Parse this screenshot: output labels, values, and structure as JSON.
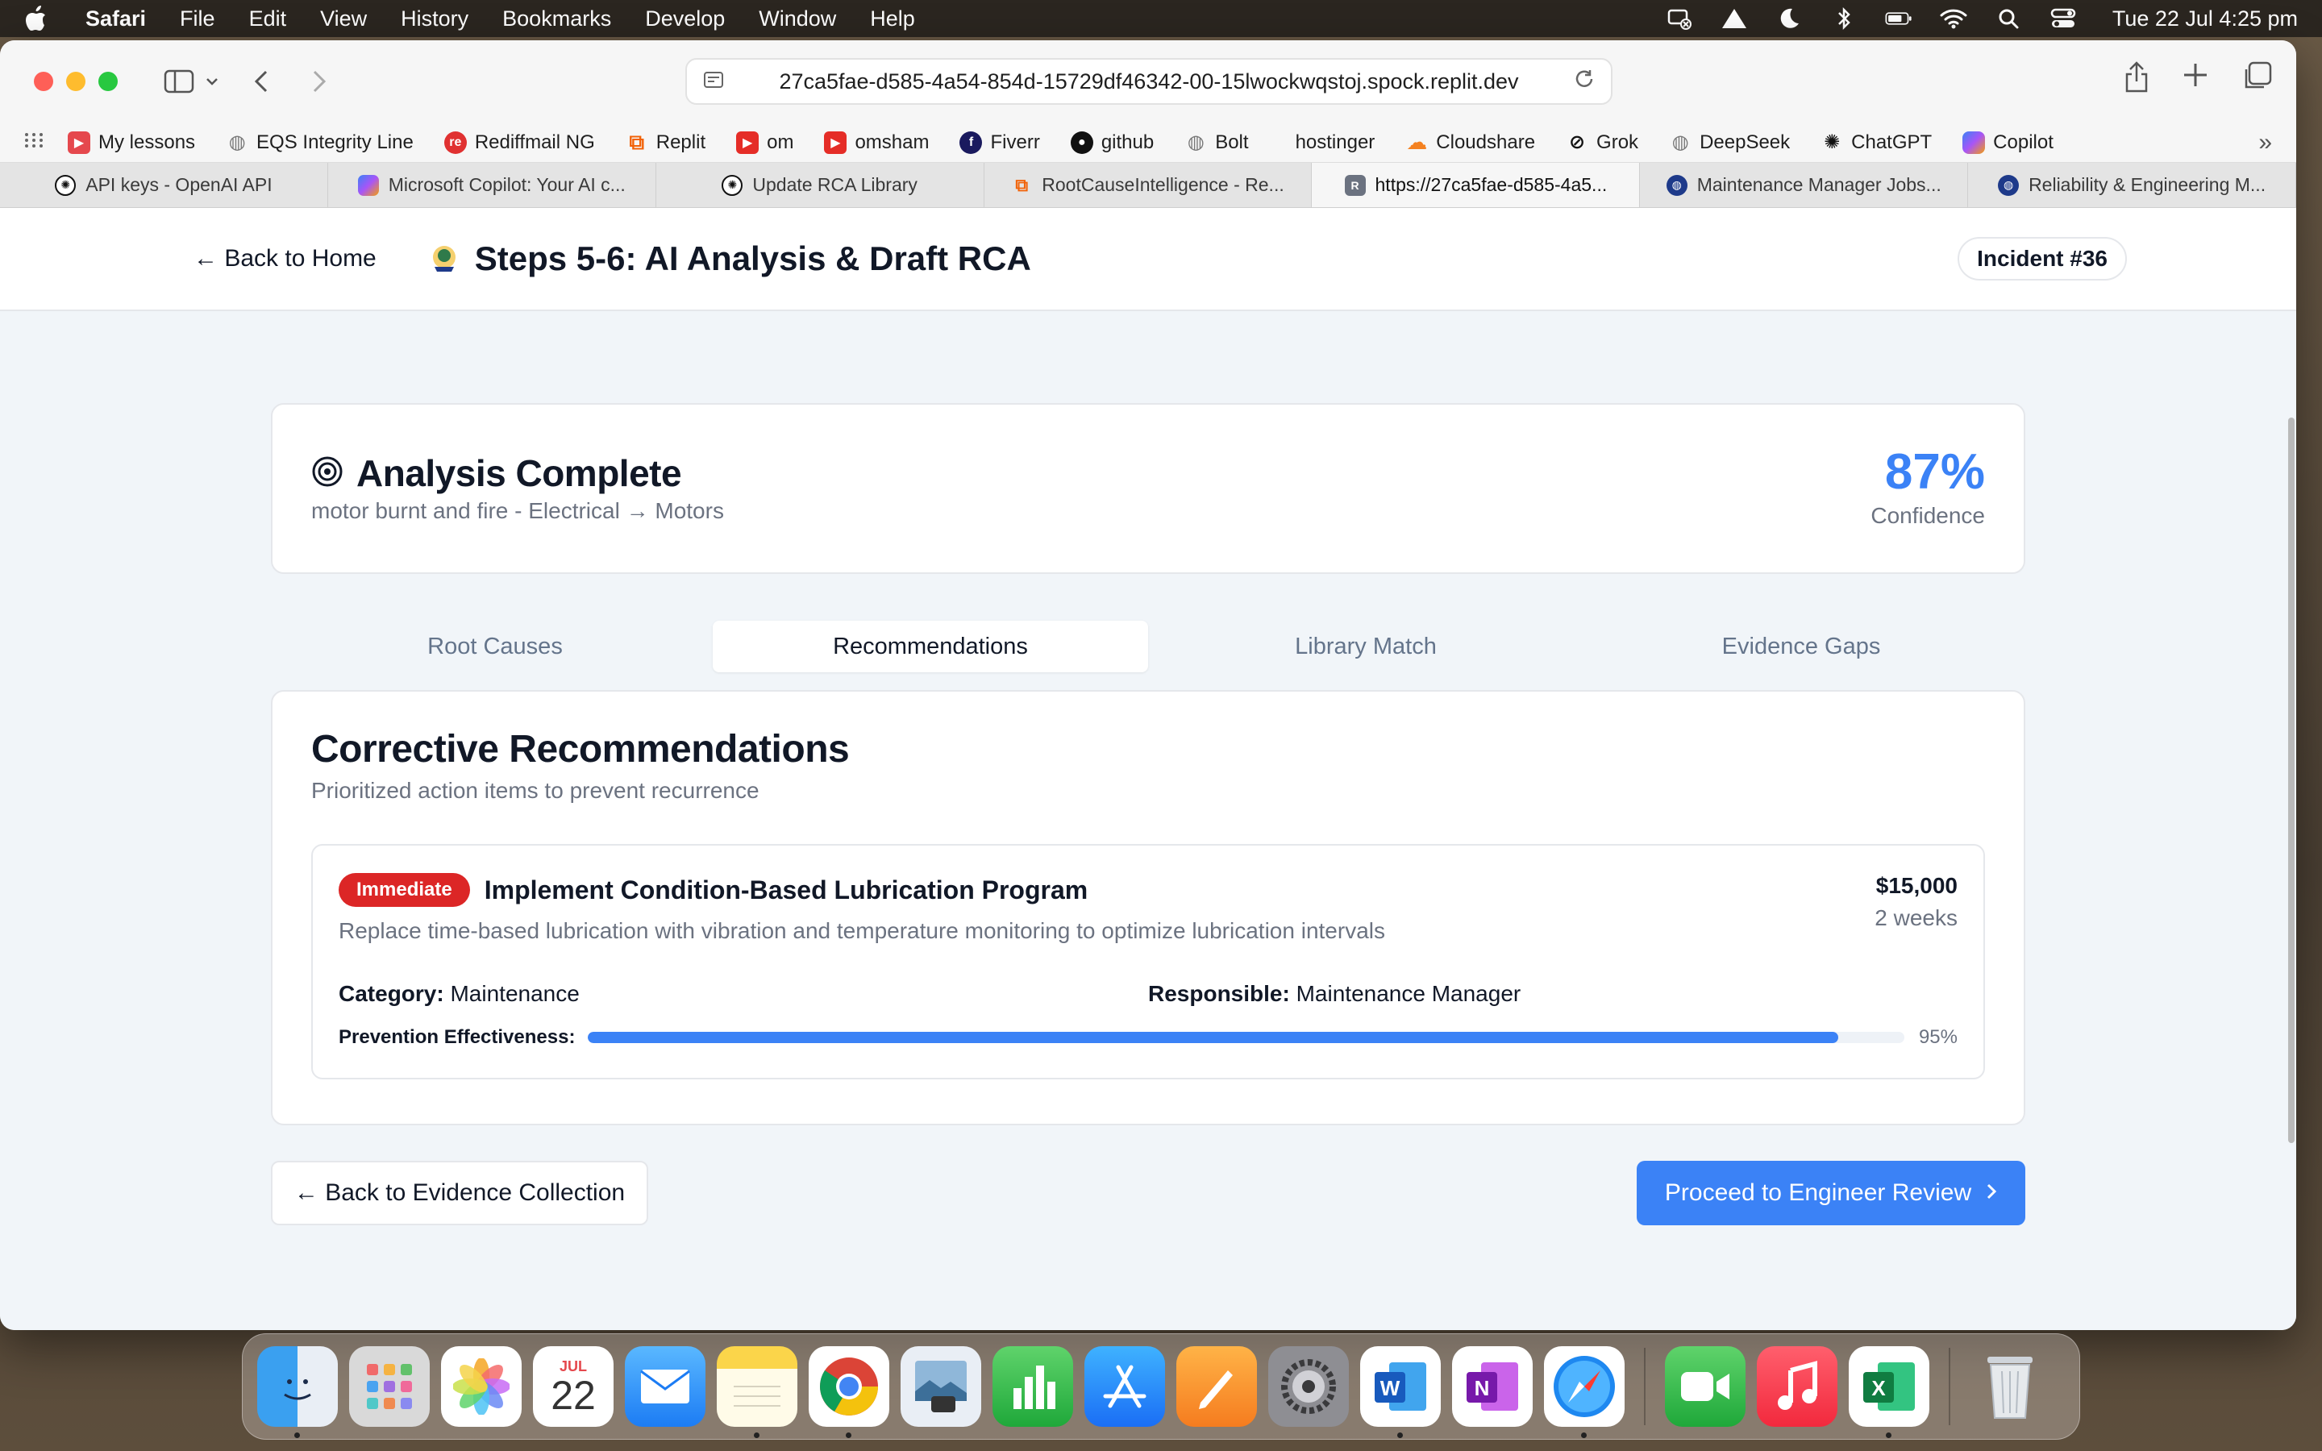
{
  "menubar": {
    "app_name": "Safari",
    "items": [
      "File",
      "Edit",
      "View",
      "History",
      "Bookmarks",
      "Develop",
      "Window",
      "Help"
    ],
    "clock": "Tue 22 Jul  4:25 pm"
  },
  "browser": {
    "url": "27ca5fae-d585-4a54-854d-15729df46342-00-15lwockwqstoj.spock.replit.dev",
    "favorites": [
      {
        "label": "My lessons",
        "icon": "play-icon",
        "color": "#e5484d"
      },
      {
        "label": "EQS Integrity Line",
        "icon": "globe-icon",
        "color": "#8a8a8a"
      },
      {
        "label": "Rediffmail NG",
        "icon": "rediff-icon",
        "color": "#e03131"
      },
      {
        "label": "Replit",
        "icon": "replit-icon",
        "color": "#f26207"
      },
      {
        "label": "om",
        "icon": "youtube-icon",
        "color": "#e52d27"
      },
      {
        "label": "omsham",
        "icon": "youtube-icon",
        "color": "#e52d27"
      },
      {
        "label": "Fiverr",
        "icon": "fiverr-icon",
        "color": "#1a1a5e"
      },
      {
        "label": "github",
        "icon": "github-icon",
        "color": "#111111"
      },
      {
        "label": "Bolt",
        "icon": "globe-icon",
        "color": "#8a8a8a"
      },
      {
        "label": "hostinger",
        "icon": "none",
        "color": "transparent"
      },
      {
        "label": "Cloudshare",
        "icon": "cloud-icon",
        "color": "#f48120"
      },
      {
        "label": "Grok",
        "icon": "grok-icon",
        "color": "#111111"
      },
      {
        "label": "DeepSeek",
        "icon": "globe-icon",
        "color": "#8a8a8a"
      },
      {
        "label": "ChatGPT",
        "icon": "openai-icon",
        "color": "#111111"
      },
      {
        "label": "Copilot",
        "icon": "copilot-icon",
        "color": "#7b61ff"
      }
    ],
    "tabs": [
      {
        "label": "API keys - OpenAI API",
        "icon": "openai-icon",
        "color": "#111111",
        "active": false
      },
      {
        "label": "Microsoft Copilot: Your AI c...",
        "icon": "copilot-icon",
        "color": "#7b61ff",
        "active": false
      },
      {
        "label": "Update RCA Library",
        "icon": "openai-icon",
        "color": "#111111",
        "active": false
      },
      {
        "label": "RootCauseIntelligence - Re...",
        "icon": "replit-icon",
        "color": "#f26207",
        "active": false
      },
      {
        "label": "https://27ca5fae-d585-4a5...",
        "icon": "r-icon",
        "color": "#6b7280",
        "active": true
      },
      {
        "label": "Maintenance Manager Jobs...",
        "icon": "globe-icon",
        "color": "#1e3a8a",
        "active": false
      },
      {
        "label": "Reliability & Engineering M...",
        "icon": "globe-icon",
        "color": "#1e3a8a",
        "active": false
      }
    ]
  },
  "header": {
    "back_label": "← Back to Home",
    "title": "Steps 5-6: AI Analysis & Draft RCA",
    "incident": "Incident #36"
  },
  "summary": {
    "title": "Analysis Complete",
    "subtitle": "motor burnt and fire - Electrical → Motors",
    "confidence_value": "87%",
    "confidence_label": "Confidence"
  },
  "analysis_tabs": [
    {
      "label": "Root Causes",
      "active": false
    },
    {
      "label": "Recommendations",
      "active": true
    },
    {
      "label": "Library Match",
      "active": false
    },
    {
      "label": "Evidence Gaps",
      "active": false
    }
  ],
  "recommendations": {
    "title": "Corrective Recommendations",
    "description": "Prioritized action items to prevent recurrence",
    "items": [
      {
        "priority": "Immediate",
        "title": "Implement Condition-Based Lubrication Program",
        "description": "Replace time-based lubrication with vibration and temperature monitoring to optimize lubrication intervals",
        "cost": "$15,000",
        "timeframe": "2 weeks",
        "category_label": "Category:",
        "category": "Maintenance",
        "responsible_label": "Responsible:",
        "responsible": "Maintenance Manager",
        "effectiveness_label": "Prevention Effectiveness:",
        "effectiveness_pct": 95,
        "effectiveness_text": "95%"
      }
    ]
  },
  "actions": {
    "back_label": "← Back to Evidence Collection",
    "proceed_label": "Proceed to Engineer Review"
  },
  "colors": {
    "accent": "#3b82f6",
    "priority_immediate": "#dc2626"
  },
  "dock": {
    "calendar_month": "JUL",
    "calendar_day": "22",
    "apps": [
      "finder-icon",
      "launchpad-icon",
      "photos-icon",
      "calendar-icon",
      "mail-icon",
      "notes-icon",
      "chrome-icon",
      "preview-icon",
      "numbers-icon",
      "app-store-icon",
      "pages-icon",
      "system-settings-icon",
      "word-icon",
      "onenote-icon",
      "safari-icon",
      "facetime-icon",
      "music-icon",
      "excel-icon",
      "trash-icon"
    ]
  }
}
